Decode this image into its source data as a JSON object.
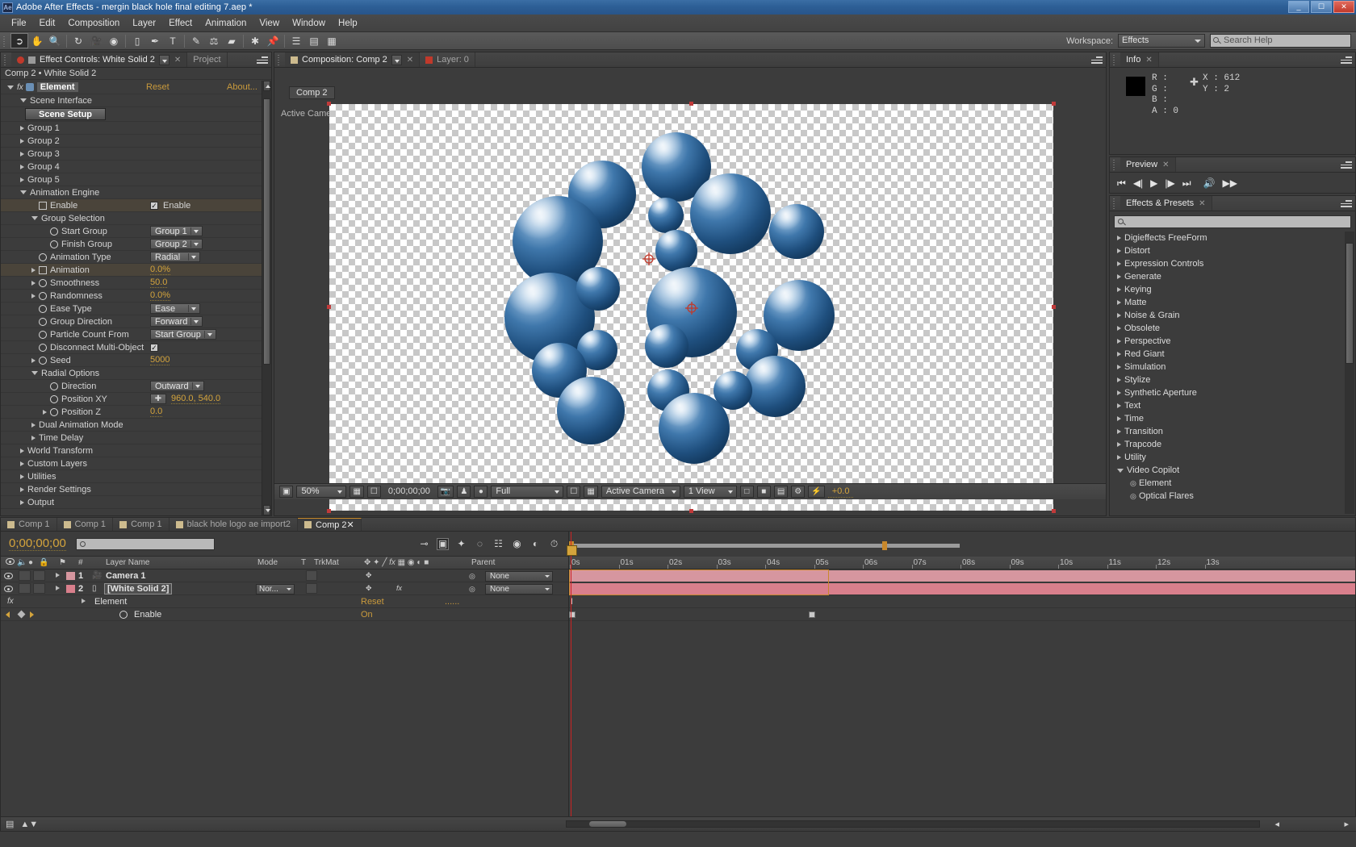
{
  "window": {
    "title": "Adobe After Effects - mergin black hole final editing 7.aep *",
    "logo": "Ae",
    "buttons": [
      "minimize",
      "maximize",
      "close"
    ]
  },
  "menu": [
    "File",
    "Edit",
    "Composition",
    "Layer",
    "Effect",
    "Animation",
    "View",
    "Window",
    "Help"
  ],
  "toolbar": {
    "workspace_label": "Workspace:",
    "workspace_value": "Effects",
    "search_help_placeholder": "Search Help",
    "tools": [
      "selection-tool",
      "hand-tool",
      "zoom-tool",
      "rotation-tool",
      "camera-tool",
      "pan-behind-tool",
      "shape-tool",
      "pen-tool",
      "type-tool",
      "brush-tool",
      "clone-stamp-tool",
      "eraser-tool",
      "roto-brush-tool",
      "puppet-pin-tool"
    ]
  },
  "effect_controls": {
    "tab_label": "Effect Controls: White Solid 2",
    "tab_project": "Project",
    "subtitle": "Comp 2 • White Solid 2",
    "effect_name": "Element",
    "reset": "Reset",
    "about": "About...",
    "scene_setup_button": "Scene Setup",
    "rows": [
      {
        "label": "Scene Interface",
        "indent": 1,
        "tri": "open"
      },
      {
        "label": "",
        "indent": 2,
        "button": "Scene Setup"
      },
      {
        "label": "Group 1",
        "indent": 1,
        "tri": "closed"
      },
      {
        "label": "Group 2",
        "indent": 1,
        "tri": "closed"
      },
      {
        "label": "Group 3",
        "indent": 1,
        "tri": "closed"
      },
      {
        "label": "Group 4",
        "indent": 1,
        "tri": "closed"
      },
      {
        "label": "Group 5",
        "indent": 1,
        "tri": "closed"
      },
      {
        "label": "Animation Engine",
        "indent": 1,
        "tri": "open"
      },
      {
        "label": "Enable",
        "indent": 2,
        "stopwatch": "boxed",
        "check": "Enable",
        "hl": true
      },
      {
        "label": "Group Selection",
        "indent": 2,
        "tri": "open"
      },
      {
        "label": "Start Group",
        "indent": 3,
        "stopwatch": "on",
        "dropdown": "Group 1"
      },
      {
        "label": "Finish Group",
        "indent": 3,
        "stopwatch": "on",
        "dropdown": "Group 2"
      },
      {
        "label": "Animation Type",
        "indent": 2,
        "stopwatch": "on",
        "dropdown": "Radial"
      },
      {
        "label": "Animation",
        "indent": 2,
        "tri": "closed",
        "stopwatch": "boxed",
        "value": "0.0%",
        "hl": true
      },
      {
        "label": "Smoothness",
        "indent": 2,
        "tri": "closed",
        "stopwatch": "on",
        "value": "50.0"
      },
      {
        "label": "Randomness",
        "indent": 2,
        "tri": "closed",
        "stopwatch": "on",
        "value": "0.0%"
      },
      {
        "label": "Ease Type",
        "indent": 2,
        "stopwatch": "on",
        "dropdown": "Ease"
      },
      {
        "label": "Group Direction",
        "indent": 2,
        "stopwatch": "on",
        "dropdown": "Forward"
      },
      {
        "label": "Particle Count From",
        "indent": 2,
        "stopwatch": "on",
        "dropdown": "Start Group"
      },
      {
        "label": "Disconnect Multi-Object",
        "indent": 2,
        "stopwatch": "on",
        "checkonly": true
      },
      {
        "label": "Seed",
        "indent": 2,
        "tri": "closed",
        "stopwatch": "on",
        "value": "5000"
      },
      {
        "label": "Radial Options",
        "indent": 2,
        "tri": "open"
      },
      {
        "label": "Direction",
        "indent": 3,
        "stopwatch": "on",
        "dropdown": "Outward"
      },
      {
        "label": "Position XY",
        "indent": 3,
        "stopwatch": "on",
        "crosshair": true,
        "value": "960.0, 540.0"
      },
      {
        "label": "Position Z",
        "indent": 3,
        "tri": "closed",
        "stopwatch": "on",
        "value": "0.0"
      },
      {
        "label": "Dual Animation Mode",
        "indent": 2,
        "tri": "closed"
      },
      {
        "label": "Time Delay",
        "indent": 2,
        "tri": "closed"
      },
      {
        "label": "World Transform",
        "indent": 1,
        "tri": "closed"
      },
      {
        "label": "Custom Layers",
        "indent": 1,
        "tri": "closed"
      },
      {
        "label": "Utilities",
        "indent": 1,
        "tri": "closed"
      },
      {
        "label": "Render Settings",
        "indent": 1,
        "tri": "closed"
      },
      {
        "label": "Output",
        "indent": 1,
        "tri": "closed"
      }
    ]
  },
  "composition": {
    "tab_label": "Composition: Comp 2",
    "layer_tab_label": "Layer: 0",
    "comp_name_tab": "Comp 2",
    "active_camera_text": "Active Camera",
    "controls": {
      "magnification": "50%",
      "current_time": "0;00;00;00",
      "resolution": "Full",
      "camera": "Active Camera",
      "views": "1 View",
      "exposure": "+0.0"
    }
  },
  "info": {
    "tab_label": "Info",
    "r_label": "R :",
    "g_label": "G :",
    "b_label": "B :",
    "a_label": "A : 0",
    "x_value": "X : 612",
    "y_value": "Y : 2",
    "swatch_color": "#000000"
  },
  "preview": {
    "tab_label": "Preview",
    "buttons": [
      "first-frame",
      "prev-frame",
      "play",
      "next-frame",
      "last-frame",
      "audio",
      "ram-preview"
    ]
  },
  "effects_presets": {
    "tab_label": "Effects & Presets",
    "search_placeholder": "",
    "items": [
      {
        "label": "Digieffects FreeForm",
        "indent": 0
      },
      {
        "label": "Distort",
        "indent": 0
      },
      {
        "label": "Expression Controls",
        "indent": 0
      },
      {
        "label": "Generate",
        "indent": 0
      },
      {
        "label": "Keying",
        "indent": 0
      },
      {
        "label": "Matte",
        "indent": 0
      },
      {
        "label": "Noise & Grain",
        "indent": 0
      },
      {
        "label": "Obsolete",
        "indent": 0
      },
      {
        "label": "Perspective",
        "indent": 0
      },
      {
        "label": "Red Giant",
        "indent": 0
      },
      {
        "label": "Simulation",
        "indent": 0
      },
      {
        "label": "Stylize",
        "indent": 0
      },
      {
        "label": "Synthetic Aperture",
        "indent": 0
      },
      {
        "label": "Text",
        "indent": 0
      },
      {
        "label": "Time",
        "indent": 0
      },
      {
        "label": "Transition",
        "indent": 0
      },
      {
        "label": "Trapcode",
        "indent": 0
      },
      {
        "label": "Utility",
        "indent": 0
      },
      {
        "label": "Video Copilot",
        "indent": 0,
        "open": true
      },
      {
        "label": "Element",
        "indent": 1
      },
      {
        "label": "Optical Flares",
        "indent": 1
      }
    ]
  },
  "timeline": {
    "tabs": [
      {
        "label": "Comp 1",
        "active": false
      },
      {
        "label": "Comp 1",
        "active": false
      },
      {
        "label": "Comp 1",
        "active": false
      },
      {
        "label": "black hole logo ae import2",
        "active": false
      },
      {
        "label": "Comp 2",
        "active": true
      }
    ],
    "current_time": "0;00;00;00",
    "search_placeholder": "",
    "columns": [
      "#",
      "Layer Name",
      "Mode",
      "T",
      "TrkMat",
      "Parent"
    ],
    "layers": [
      {
        "num": "1",
        "name": "Camera 1",
        "icon": "camera-icon",
        "mode": "",
        "parent": "None",
        "color": "#d6969f",
        "boxed": false
      },
      {
        "num": "2",
        "name": "[White Solid 2]",
        "icon": "solid-icon",
        "mode": "Nor...",
        "parent": "None",
        "color": "#d97f8c",
        "boxed": true
      }
    ],
    "effect_row": {
      "label": "Element",
      "reset": "Reset"
    },
    "property_row": {
      "label": "Enable",
      "value": "On"
    },
    "ruler_ticks": [
      "0s",
      "01s",
      "02s",
      "03s",
      "04s",
      "05s",
      "06s",
      "07s",
      "08s",
      "09s",
      "10s",
      "11s",
      "12s",
      "13s"
    ]
  }
}
